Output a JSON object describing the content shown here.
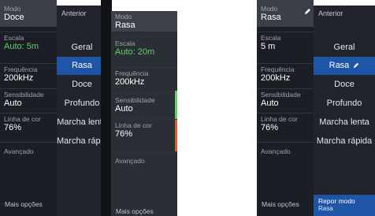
{
  "left_screen": {
    "menu": [
      {
        "label": "Modo",
        "value": "Doce",
        "selected": true
      },
      {
        "label": "Escala",
        "value": "Auto: 5m",
        "value_color": "green"
      },
      {
        "label": "Frequência",
        "value": "200kHz"
      },
      {
        "label": "Sensibilidade",
        "value": "Auto"
      },
      {
        "label": "Linha de cor",
        "value": "76%"
      },
      {
        "label": "Avançado",
        "value": ""
      }
    ],
    "more_options": "Mais opções",
    "submenu": {
      "back": "Anterior",
      "options": [
        "Geral",
        "Rasa",
        "Doce",
        "Profundo",
        "Marcha lenta",
        "Marcha rápida"
      ],
      "active": "Rasa"
    },
    "overlay_menu": [
      {
        "label": "Modo",
        "value": "Rasa",
        "selected": true
      },
      {
        "label": "Escala",
        "value": "Auto: 20m",
        "value_color": "green"
      },
      {
        "label": "Frequência",
        "value": "200kHz"
      },
      {
        "label": "Sensibilidade",
        "value": "Auto"
      },
      {
        "label": "Linha de cor",
        "value": "76%"
      },
      {
        "label": "Avançado",
        "value": ""
      }
    ],
    "overlay_more_options": "Mais opções"
  },
  "right_screen": {
    "menu": [
      {
        "label": "Modo",
        "value": "Rasa",
        "selected": true
      },
      {
        "label": "Escala",
        "value": "5 m"
      },
      {
        "label": "Frequência",
        "value": "200kHz"
      },
      {
        "label": "Sensibilidade",
        "value": "Auto"
      },
      {
        "label": "Linha de cor",
        "value": "76%"
      },
      {
        "label": "Avançado",
        "value": ""
      }
    ],
    "more_options": "Mais opções",
    "submenu": {
      "back": "Anterior",
      "options": [
        "Geral",
        "Rasa",
        "Doce",
        "Profundo",
        "Marcha lenta",
        "Marcha rápida"
      ],
      "active": "Rasa",
      "reset_label": "Repor modo",
      "reset_sub": "Rasa"
    }
  },
  "colors": {
    "accent": "#1f55a6",
    "green": "#62d06a",
    "orange": "#e05a2a",
    "panel": "#1b1e24"
  },
  "icons": [
    "pencil-icon"
  ]
}
